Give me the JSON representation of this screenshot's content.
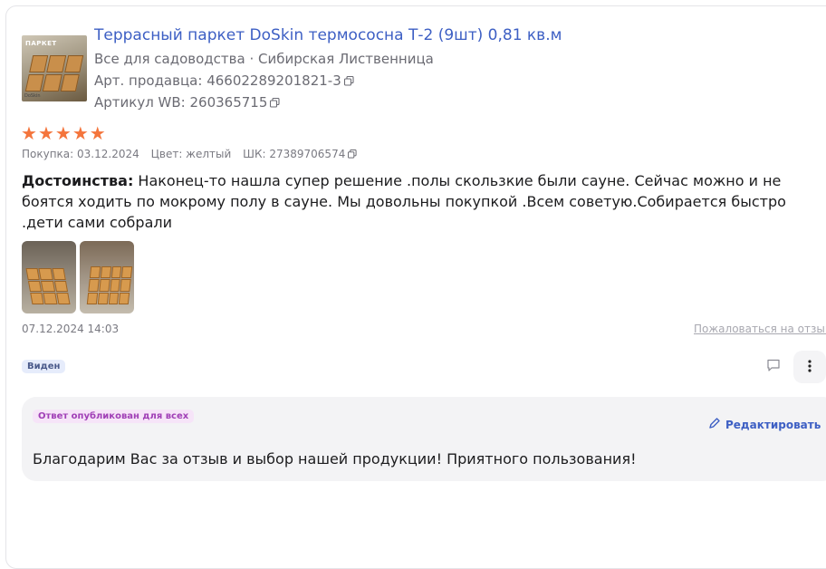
{
  "product": {
    "title": "Террасный паркет DoSkin термососна Т-2 (9шт) 0,81 кв.м",
    "category": "Все для садоводства · Сибирская Лиственница",
    "seller_article": "Арт. продавца: 46602289201821-3",
    "wb_article": "Артикул WB: 260365715",
    "thumb_label": "ПАРКЕТ",
    "thumb_brand": "DoSkin"
  },
  "review": {
    "rating": 5,
    "stars": [
      "★",
      "★",
      "★",
      "★",
      "★"
    ],
    "star_color": "#f4753c",
    "purchase": "Покупка: 03.12.2024",
    "color": "Цвет: желтый",
    "barcode": "ШК: 27389706574",
    "pros_label": "Достоинства:",
    "pros_text": " Наконец-то нашла супер решение .полы скользкие были сауне. Сейчас можно и не боятся ходить по мокрому полу в сауне. Мы довольны покупкой .Всем советую.Собирается быстро .дети сами собрали",
    "photos_count": 2,
    "date": "07.12.2024 14:03",
    "complain_label": "Пожаловаться на отзыв",
    "seen_badge": "Виден"
  },
  "answer": {
    "badge": "Ответ опубликован для всех",
    "edit_label": "Редактировать",
    "text": "Благодарим Вас за отзыв и выбор нашей продукции! Приятного пользования!"
  },
  "colors": {
    "link": "#3d5fc4",
    "answer_badge": "#a03fb6",
    "seen_badge_bg": "#e6ecfb"
  },
  "icons": {
    "copy": "copy-icon",
    "comment": "comment-icon",
    "more": "more-vertical-icon",
    "edit": "pencil-icon"
  }
}
